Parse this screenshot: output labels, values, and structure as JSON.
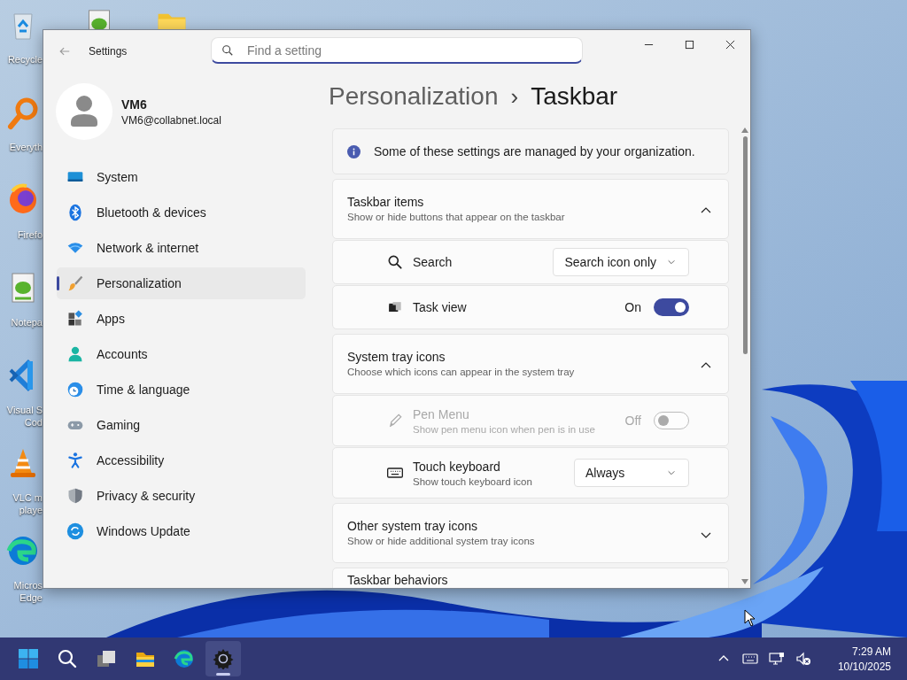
{
  "desktop": {
    "top_icons": [
      {
        "kind": "notepad"
      },
      {
        "kind": "folder"
      }
    ],
    "icons": [
      {
        "kind": "recycle",
        "lines": [
          "Recycle"
        ]
      },
      {
        "kind": "magnifier",
        "lines": [
          "Everyth"
        ]
      },
      {
        "kind": "firefox",
        "lines": [
          "Firefo"
        ]
      },
      {
        "kind": "notepad",
        "lines": [
          "Notepa"
        ]
      },
      {
        "kind": "vscode",
        "lines": [
          "Visual S",
          "Cod"
        ]
      },
      {
        "kind": "vlc",
        "lines": [
          "VLC m",
          "playe"
        ]
      },
      {
        "kind": "edge",
        "lines": [
          "Micros",
          "Edge"
        ]
      }
    ]
  },
  "window": {
    "title": "Settings",
    "search": {
      "placeholder": "Find a setting"
    }
  },
  "account": {
    "name": "VM6",
    "email": "VM6@collabnet.local"
  },
  "nav": [
    {
      "label": "System",
      "selected": false
    },
    {
      "label": "Bluetooth & devices",
      "selected": false
    },
    {
      "label": "Network & internet",
      "selected": false
    },
    {
      "label": "Personalization",
      "selected": true
    },
    {
      "label": "Apps",
      "selected": false
    },
    {
      "label": "Accounts",
      "selected": false
    },
    {
      "label": "Time & language",
      "selected": false
    },
    {
      "label": "Gaming",
      "selected": false
    },
    {
      "label": "Accessibility",
      "selected": false
    },
    {
      "label": "Privacy & security",
      "selected": false
    },
    {
      "label": "Windows Update",
      "selected": false
    }
  ],
  "breadcrumb": {
    "parent": "Personalization",
    "separator": "›",
    "current": "Taskbar"
  },
  "notice": "Some of these settings are managed by your organization.",
  "sections": [
    {
      "title": "Taskbar items",
      "subtitle": "Show or hide buttons that appear on the taskbar",
      "expanded": true,
      "rows": [
        {
          "kind": "dropdown",
          "label": "Search",
          "value": "Search icon only",
          "disabled": false
        },
        {
          "kind": "toggle",
          "label": "Task view",
          "state_text": "On",
          "on": true,
          "disabled": false
        }
      ]
    },
    {
      "title": "System tray icons",
      "subtitle": "Choose which icons can appear in the system tray",
      "expanded": true,
      "rows": [
        {
          "kind": "toggle",
          "label": "Pen Menu",
          "description": "Show pen menu icon when pen is in use",
          "state_text": "Off",
          "on": false,
          "disabled": true
        },
        {
          "kind": "dropdown",
          "label": "Touch keyboard",
          "description": "Show touch keyboard icon",
          "value": "Always",
          "disabled": false
        }
      ]
    },
    {
      "title": "Other system tray icons",
      "subtitle": "Show or hide additional system tray icons",
      "expanded": false
    },
    {
      "title": "Taskbar behaviors"
    }
  ],
  "taskbar": {
    "apps": [
      {
        "kind": "start",
        "selected": false
      },
      {
        "kind": "search",
        "selected": false
      },
      {
        "kind": "taskview",
        "selected": false
      },
      {
        "kind": "explorer",
        "selected": false
      },
      {
        "kind": "edge",
        "selected": false
      },
      {
        "kind": "settings",
        "selected": true
      }
    ],
    "clock": {
      "time": "7:29 AM",
      "date": "10/10/2025"
    }
  }
}
